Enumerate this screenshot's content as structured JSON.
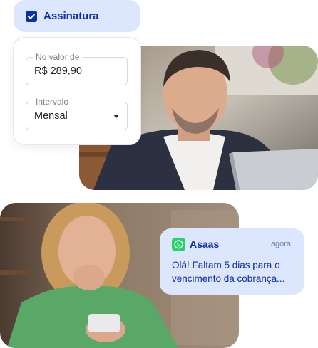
{
  "subscription": {
    "checkbox_label": "Assinatura",
    "checked": true
  },
  "form": {
    "amount_legend": "No valor de",
    "amount_value": "R$ 289,90",
    "interval_legend": "Intervalo",
    "interval_value": "Mensal"
  },
  "notification": {
    "app_icon": "whatsapp-icon",
    "sender": "Asaas",
    "time": "agora",
    "message_line1": "Olá! Faltam 5 dias para o",
    "message_line2": "vencimento da cobrança..."
  },
  "colors": {
    "accent": "#0b2fa6",
    "chip_bg": "#dce6fd",
    "whatsapp_green": "#25d366"
  }
}
